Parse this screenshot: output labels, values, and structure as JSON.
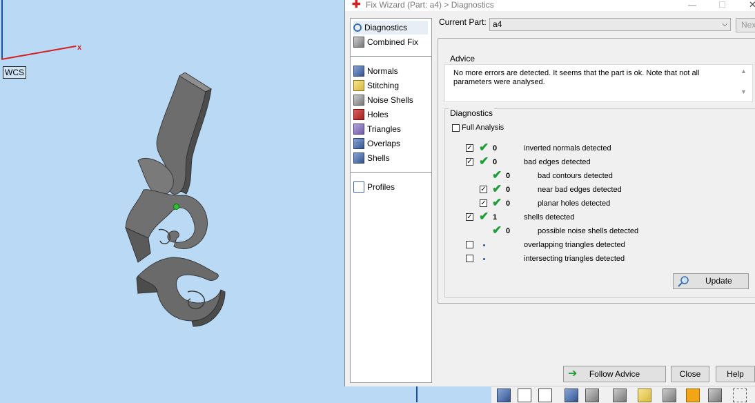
{
  "viewport": {
    "wcs_label": "WCS",
    "axis_x_label": "x"
  },
  "window": {
    "title": "Fix Wizard (Part: a4) > Diagnostics",
    "min": "—",
    "max": "☐",
    "close": "✕"
  },
  "nav": {
    "items": [
      {
        "label": "Diagnostics",
        "icon": "search-icon"
      },
      {
        "label": "Combined Fix",
        "icon": "combined-fix-icon"
      },
      {
        "label": "Normals",
        "icon": "normals-icon"
      },
      {
        "label": "Stitching",
        "icon": "stitching-icon"
      },
      {
        "label": "Noise Shells",
        "icon": "noise-shells-icon"
      },
      {
        "label": "Holes",
        "icon": "holes-icon"
      },
      {
        "label": "Triangles",
        "icon": "triangles-icon"
      },
      {
        "label": "Overlaps",
        "icon": "overlaps-icon"
      },
      {
        "label": "Shells",
        "icon": "shells-icon"
      },
      {
        "label": "Profiles",
        "icon": "profiles-icon"
      }
    ]
  },
  "current_part": {
    "label": "Current Part:",
    "value": "a4",
    "next_label": "Nex"
  },
  "advice": {
    "group_label": "Advice",
    "text": "No more errors are detected. It seems that the part is ok. Note that not all parameters were analysed."
  },
  "diagnostics": {
    "group_label": "Diagnostics",
    "full_analysis_label": "Full Analysis",
    "rows": [
      {
        "checked": true,
        "status": "ok",
        "count": "0",
        "label": "inverted normals detected"
      },
      {
        "checked": true,
        "status": "ok",
        "count": "0",
        "label": "bad edges detected"
      },
      {
        "checked": null,
        "status": "ok",
        "count": "0",
        "label": "bad contours detected"
      },
      {
        "checked": true,
        "status": "ok",
        "count": "0",
        "label": "near bad edges detected"
      },
      {
        "checked": true,
        "status": "ok",
        "count": "0",
        "label": "planar holes detected"
      },
      {
        "checked": true,
        "status": "ok",
        "count": "1",
        "label": "shells detected"
      },
      {
        "checked": null,
        "status": "ok",
        "count": "0",
        "label": "possible noise shells detected"
      },
      {
        "checked": false,
        "status": "pending",
        "count": "",
        "label": "overlapping triangles detected"
      },
      {
        "checked": false,
        "status": "pending",
        "count": "",
        "label": "intersecting triangles detected"
      }
    ],
    "update_label": "Update"
  },
  "buttons": {
    "follow_advice": "Follow Advice",
    "close": "Close",
    "help": "Help"
  },
  "colors": {
    "viewport_bg": "#b9d9f5",
    "check_green": "#1c9d3a",
    "window_bg": "#f0f0f0"
  }
}
